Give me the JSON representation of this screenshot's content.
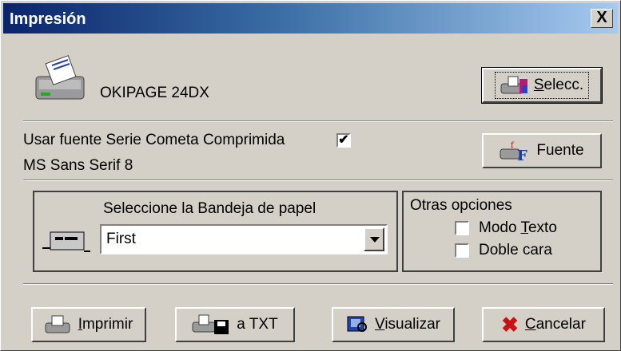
{
  "window": {
    "title": "Impresión",
    "close_label": "X"
  },
  "printer": {
    "name": "OKIPAGE 24DX",
    "icon": "printer-icon"
  },
  "buttons": {
    "select": {
      "label": "Selecc.",
      "mnemonic": "S",
      "rest": "elecc."
    },
    "font": {
      "label": "Fuente"
    },
    "print": {
      "mnemonic": "I",
      "rest": "mprimir"
    },
    "txt": {
      "label": "a TXT"
    },
    "preview": {
      "mnemonic": "V",
      "rest": "isualizar"
    },
    "cancel": {
      "mnemonic": "C",
      "rest": "ancelar"
    }
  },
  "font_option": {
    "label": "Usar fuente Serie Cometa Comprimida",
    "checked": "✔",
    "current_font": "MS Sans Serif 8"
  },
  "tray": {
    "label": "Seleccione la Bandeja  de papel",
    "selected": "First"
  },
  "other_options": {
    "title": "Otras opciones",
    "text_mode": {
      "mnemonic": "T",
      "prefix": "Modo ",
      "rest": "exto"
    },
    "duplex": {
      "label": "Doble cara"
    }
  },
  "colors": {
    "title_gradient_start": "#0a246a",
    "title_gradient_end": "#a6caf0",
    "face": "#d4d0c8",
    "cancel_x": "#cc1111"
  }
}
